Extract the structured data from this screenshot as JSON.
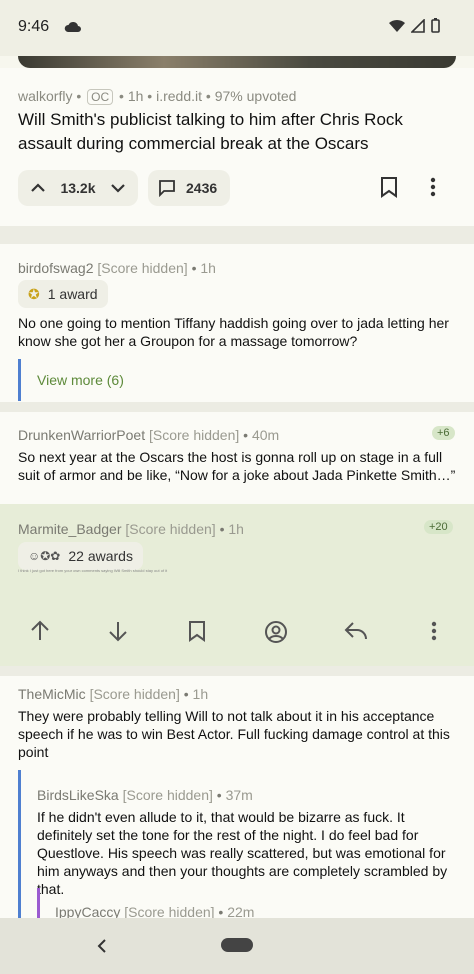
{
  "status_bar": {
    "time": "9:46",
    "icons": [
      "cloud-icon",
      "wifi-icon",
      "signal-icon",
      "battery-icon"
    ]
  },
  "post": {
    "author": "walkorfly",
    "flair": "OC",
    "age": "1h",
    "domain": "i.redd.it",
    "upvoted": "97% upvoted",
    "title": "Will Smith's publicist talking to him after Chris Rock assault during commercial break at the Oscars",
    "score": "13.2k",
    "comments": "2436"
  },
  "comments": [
    {
      "user": "birdofswag2",
      "score": "[Score hidden]",
      "age": "1h",
      "award": "1 award",
      "text": "No one going to mention Tiffany haddish going over to jada letting her know she got her a Groupon for a massage tomorrow?",
      "view_more": "View more (6)"
    },
    {
      "user": "DrunkenWarriorPoet",
      "score": "[Score hidden]",
      "age": "40m",
      "badge": "+6",
      "text": "So next year at the Oscars the host is gonna roll up on stage in a full suit of armor and be like, “Now for a joke about Jada Pinkette Smith…”"
    },
    {
      "user": "Marmite_Badger",
      "score": "[Score hidden]",
      "age": "1h",
      "badge": "+20",
      "award": "22 awards",
      "text": "I think I just got here from your own comments saying Will Smith should stay out of it"
    },
    {
      "user": "TheMicMic",
      "score": "[Score hidden]",
      "age": "1h",
      "text": "They were probably telling Will to not talk about it in his acceptance speech if he was to win Best Actor. Full fucking damage control at this point"
    },
    {
      "user": "BirdsLikeSka",
      "score": "[Score hidden]",
      "age": "37m",
      "text": "If he didn't even allude to it, that would be bizarre as fuck. It definitely set the tone for the rest of the night. I do feel bad for Questlove. His speech was really scattered, but was emotional for him anyways and then your thoughts are completely scrambled by that."
    },
    {
      "user": "IppyCaccy",
      "score": "[Score hidden]",
      "age": "22m"
    }
  ],
  "colors": {
    "accent_blue": "#4f7fd0",
    "accent_green": "#5d8a3a",
    "highlight": "#e7edd8"
  }
}
